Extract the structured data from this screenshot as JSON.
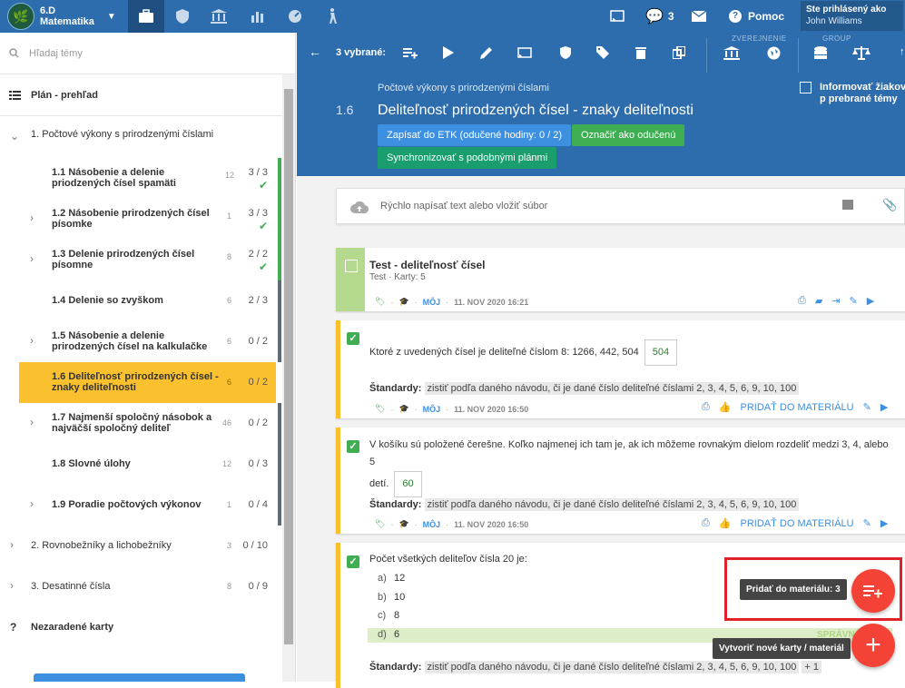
{
  "topbar": {
    "class_name": "6.D",
    "subject": "Matematika",
    "notifications_count": "3",
    "help_label": "Pomoc",
    "logged_in_label": "Ste prihlásený ako",
    "user_name": "John Williams"
  },
  "sidebar": {
    "search_placeholder": "Hľadaj témy",
    "plan_label": "Plán - prehľad",
    "topics": [
      {
        "label": "1. Počtové výkony s prirodzenými číslami"
      },
      {
        "label": "1.1  Násobenie a delenie priodzených čísel spamäti",
        "count": "12",
        "progress": "3 / 3"
      },
      {
        "label": "1.2  Násobenie prirodzených čísel písomke",
        "count": "1",
        "progress": "3 / 3"
      },
      {
        "label": "1.3  Delenie prirodzených čísel písomne",
        "count": "8",
        "progress": "2 / 2"
      },
      {
        "label": "1.4  Delenie so zvyškom",
        "count": "6",
        "progress": "2 / 3"
      },
      {
        "label": "1.5  Násobenie a delenie prirodzených čísel na kalkulačke",
        "count": "6",
        "progress": "0 / 2"
      },
      {
        "label": "1.6  Deliteľnosť prirodzených čísel - znaky deliteľnosti",
        "count": "6",
        "progress": "0 / 2"
      },
      {
        "label": "1.7  Najmenší spoločný násobok a najväčší spoločný deliteľ",
        "count": "46",
        "progress": "0 / 2"
      },
      {
        "label": "1.8  Slovné úlohy",
        "count": "12",
        "progress": "0 / 3"
      },
      {
        "label": "1.9  Poradie počtových výkonov",
        "count": "1",
        "progress": "0 / 4"
      },
      {
        "label": "2. Rovnobežníky a lichobežníky",
        "count": "3",
        "progress": "0 / 10"
      },
      {
        "label": "3. Desatinné čísla",
        "count": "8",
        "progress": "0 / 9"
      },
      {
        "label": "Nezaradené karty"
      }
    ]
  },
  "toolbar": {
    "selected_label": "3 vybrané:",
    "group_public": "ZVEREJNENIE",
    "group_group": "GROUP"
  },
  "header": {
    "breadcrumb": "Počtové výkony s prirodzenými číslami",
    "number": "1.6",
    "title": "Deliteľnosť prirodzených čísel - znaky deliteľnosti",
    "btn_etk": "Zapísať do ETK (odučené hodiny: 0 / 2)",
    "btn_taught": "Označiť ako odučenú",
    "btn_sync": "Synchronizovať s podobnými plánmi",
    "inform_students": "Informovať žiakov p prebrané témy"
  },
  "quick_input_placeholder": "Rýchlo napísať text alebo vložiť súbor",
  "cards": {
    "test": {
      "title": "Test - deliteľnosť čísel",
      "subtitle": "Test · Karty: 5",
      "owner": "MÔJ",
      "date": "11. NOV 2020 16:21"
    },
    "q1": {
      "question": "Ktoré z uvedených čísel je deliteľné číslom 8: 1266, 442, 504",
      "answer": "504",
      "standards_label": "Štandardy:",
      "standard": "zistiť podľa daného návodu, či je dané číslo deliteľné číslami 2, 3, 4, 5, 6, 9, 10, 100",
      "owner": "MÔJ",
      "date": "11. NOV 2020 16:50",
      "add_label": "PRIDAŤ DO MATERIÁLU"
    },
    "q2": {
      "question_line1": "V košíku sú položené čerešne. Koľko najmenej ich tam je, ak ich môžeme rovnakým dielom rozdeliť medzi 3, 4, alebo 5",
      "question_line2": "detí.",
      "answer": "60",
      "standards_label": "Štandardy:",
      "standard": "zistiť podľa daného návodu, či je dané číslo deliteľné číslami 2, 3, 4, 5, 6, 9, 10, 100",
      "owner": "MÔJ",
      "date": "11. NOV 2020 16:50",
      "add_label": "PRIDAŤ DO MATERIÁLU"
    },
    "q3": {
      "question": "Počet všetkých deliteľov čísla 20 je:",
      "options": [
        {
          "letter": "a)",
          "text": "12"
        },
        {
          "letter": "b)",
          "text": "10"
        },
        {
          "letter": "c)",
          "text": "8"
        },
        {
          "letter": "d)",
          "text": "6"
        }
      ],
      "correct_label": "SPRÁVNA ODP",
      "standards_label": "Štandardy:",
      "standard": "zistiť podľa daného návodu, či je dané číslo deliteľné číslami 2, 3, 4, 5, 6, 9, 10, 100",
      "extra": "+ 1"
    }
  },
  "fab": {
    "add_to_material_tooltip": "Pridať do materiálu: 3",
    "create_tooltip": "Vytvoriť nové karty / materiál"
  },
  "colors": {
    "primary": "#2d6dad",
    "accent_yellow": "#fbc02d",
    "green": "#3fae52",
    "fab_red": "#f44336",
    "highlight_border": "#e0232b"
  }
}
